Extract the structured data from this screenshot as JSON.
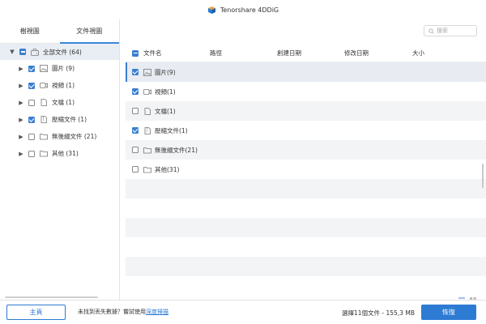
{
  "titlebar": {
    "title": "Tenorshare 4DDiG"
  },
  "left_pane": {
    "tabs": [
      {
        "label": "樹視圖",
        "active": false
      },
      {
        "label": "文件視圖",
        "active": true
      }
    ],
    "tree": {
      "root": {
        "label": "全部文件 (64)",
        "check": "partial",
        "expanded": true
      },
      "items": [
        {
          "label": "圖片 (9)",
          "checked": true,
          "icon": "image-icon"
        },
        {
          "label": "視頻 (1)",
          "checked": true,
          "icon": "video-icon"
        },
        {
          "label": "文檔 (1)",
          "checked": false,
          "icon": "document-icon"
        },
        {
          "label": "壓縮文件 (1)",
          "checked": true,
          "icon": "archive-icon"
        },
        {
          "label": "無後綴文件 (21)",
          "checked": false,
          "icon": "folder-icon"
        },
        {
          "label": "其他 (31)",
          "checked": false,
          "icon": "folder-icon"
        }
      ]
    }
  },
  "search": {
    "placeholder": "搜索"
  },
  "grid": {
    "columns": {
      "name": "文件名",
      "path": "路徑",
      "created": "創建日期",
      "modified": "修改日期",
      "size": "大小"
    },
    "header_check": "partial",
    "rows": [
      {
        "name": "圖片(9)",
        "checked": true,
        "icon": "image-icon",
        "selected": true
      },
      {
        "name": "視頻(1)",
        "checked": true,
        "icon": "video-icon",
        "selected": false
      },
      {
        "name": "文檔(1)",
        "checked": false,
        "icon": "document-icon",
        "selected": false
      },
      {
        "name": "壓縮文件(1)",
        "checked": true,
        "icon": "archive-icon",
        "selected": false
      },
      {
        "name": "無後綴文件(21)",
        "checked": false,
        "icon": "folder-icon",
        "selected": false
      },
      {
        "name": "其他(31)",
        "checked": false,
        "icon": "folder-icon",
        "selected": false
      }
    ]
  },
  "bottombar": {
    "home_label": "主頁",
    "hint_prefix": "未找到丟失數據？嘗試使用",
    "hint_link": "深度掃描",
    "status": "選擇11個文件 - 155,3 MB",
    "recover_label": "恢復"
  },
  "colors": {
    "accent": "#2e7bd3",
    "selected_row": "#e8ecf2"
  }
}
